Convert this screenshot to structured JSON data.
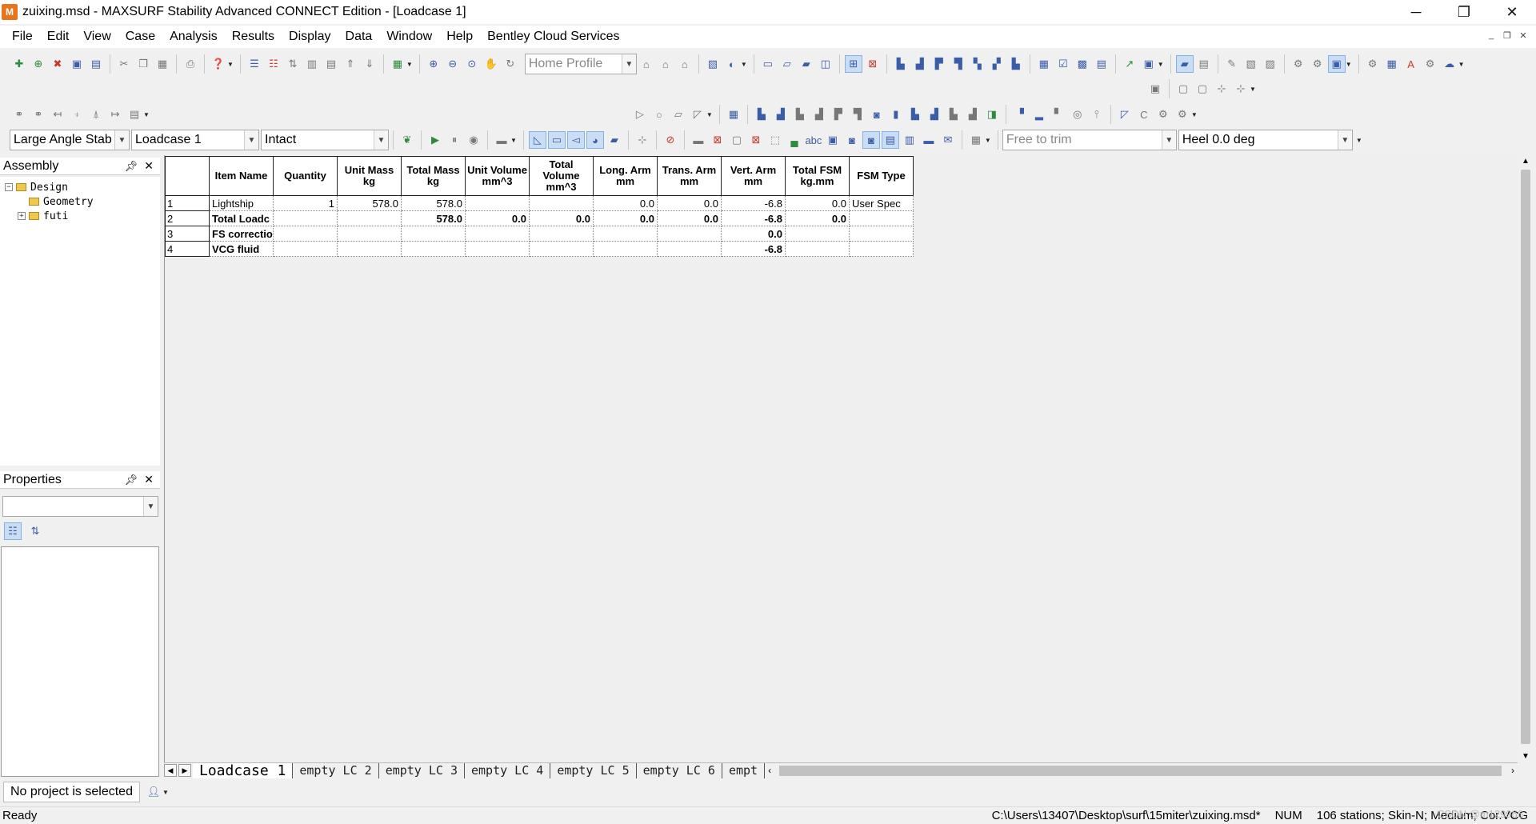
{
  "window": {
    "title": "zuixing.msd - MAXSURF Stability Advanced CONNECT Edition - [Loadcase 1]",
    "icon_text": "M"
  },
  "menu": [
    "File",
    "Edit",
    "View",
    "Case",
    "Analysis",
    "Results",
    "Display",
    "Data",
    "Window",
    "Help",
    "Bentley Cloud Services"
  ],
  "toolbar": {
    "home_profile": "Home Profile",
    "analysis_type": "Large Angle Stab",
    "loadcase": "Loadcase 1",
    "damage": "Intact",
    "trim": "Free to trim",
    "heel": "Heel 0.0 deg"
  },
  "assembly": {
    "title": "Assembly",
    "tree": [
      {
        "label": "Design",
        "level": 0,
        "expander": "−"
      },
      {
        "label": "Geometry",
        "level": 1,
        "expander": ""
      },
      {
        "label": "futi",
        "level": 1,
        "expander": "+"
      }
    ]
  },
  "properties": {
    "title": "Properties"
  },
  "grid": {
    "columns": [
      "Item Name",
      "Quantity",
      "Unit Mass kg",
      "Total Mass kg",
      "Unit Volume mm^3",
      "Total Volume mm^3",
      "Long. Arm mm",
      "Trans. Arm mm",
      "Vert. Arm mm",
      "Total FSM kg.mm",
      "FSM Type"
    ],
    "rows": [
      {
        "n": "1",
        "cells": [
          "Lightship",
          "1",
          "578.0",
          "578.0",
          "",
          "",
          "0.0",
          "0.0",
          "-6.8",
          "0.0",
          "User Spec"
        ],
        "bold": false
      },
      {
        "n": "2",
        "cells": [
          "Total Loadc",
          "",
          "",
          "578.0",
          "0.0",
          "0.0",
          "0.0",
          "0.0",
          "-6.8",
          "0.0",
          ""
        ],
        "bold": true
      },
      {
        "n": "3",
        "cells": [
          "FS correctio",
          "",
          "",
          "",
          "",
          "",
          "",
          "",
          "0.0",
          "",
          ""
        ],
        "bold": true
      },
      {
        "n": "4",
        "cells": [
          "VCG fluid",
          "",
          "",
          "",
          "",
          "",
          "",
          "",
          "-6.8",
          "",
          ""
        ],
        "bold": true
      }
    ]
  },
  "tabs": [
    "Loadcase 1",
    "empty LC 2",
    "empty LC 3",
    "empty LC 4",
    "empty LC 5",
    "empty LC 6",
    "empt"
  ],
  "project_status": "No project is selected",
  "status": {
    "ready": "Ready",
    "path": "C:\\Users\\13407\\Desktop\\surf\\15miter\\zuixing.msd*",
    "num": "NUM",
    "info": "106 stations; Skin-N; Medium; Cor.VCG"
  },
  "watermark": "CSDN @m129966"
}
